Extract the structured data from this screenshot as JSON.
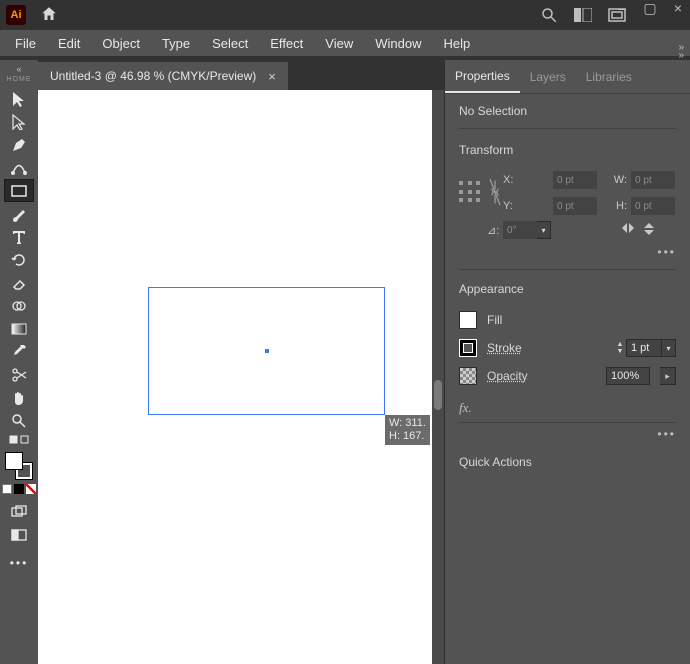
{
  "app": {
    "icon_text": "Ai"
  },
  "window_controls": {
    "minimize": "–",
    "maximize": "▢",
    "close": "×"
  },
  "menubar": [
    "File",
    "Edit",
    "Object",
    "Type",
    "Select",
    "Effect",
    "View",
    "Window",
    "Help"
  ],
  "toolbox": {
    "home_label": "HOME",
    "tools": [
      {
        "name": "selection-tool",
        "selected": false
      },
      {
        "name": "direct-selection-tool",
        "selected": false
      },
      {
        "name": "pen-tool",
        "selected": false
      },
      {
        "name": "curvature-tool",
        "selected": false
      },
      {
        "name": "rectangle-tool",
        "selected": true
      },
      {
        "name": "paintbrush-tool",
        "selected": false
      },
      {
        "name": "type-tool",
        "selected": false
      },
      {
        "name": "rotate-tool",
        "selected": false
      },
      {
        "name": "eraser-tool",
        "selected": false
      },
      {
        "name": "shape-builder-tool",
        "selected": false
      },
      {
        "name": "gradient-tool",
        "selected": false
      },
      {
        "name": "eyedropper-tool",
        "selected": false
      },
      {
        "name": "scissors-tool",
        "selected": false
      },
      {
        "name": "hand-tool",
        "selected": false
      },
      {
        "name": "zoom-tool",
        "selected": false
      }
    ],
    "small_tools": [
      {
        "name": "drawing-mode-normal-icon"
      },
      {
        "name": "screen-mode-icon"
      }
    ]
  },
  "document": {
    "tab_title": "Untitled-3 @ 46.98 % (CMYK/Preview)",
    "dim_tip": "W: 311.\nH: 167."
  },
  "right_panel": {
    "tabs": [
      "Properties",
      "Layers",
      "Libraries"
    ],
    "active_tab": 0,
    "status": "No Selection",
    "transform": {
      "title": "Transform",
      "x_label": "X:",
      "x_value": "0 pt",
      "y_label": "Y:",
      "y_value": "0 pt",
      "w_label": "W:",
      "w_value": "0 pt",
      "h_label": "H:",
      "h_value": "0 pt",
      "angle_label": "⊿:",
      "angle_value": "0°"
    },
    "appearance": {
      "title": "Appearance",
      "fill_label": "Fill",
      "stroke_label": "Stroke",
      "stroke_value": "1 pt",
      "opacity_label": "Opacity",
      "opacity_value": "100%",
      "fx_label": "fx."
    },
    "quick_actions_title": "Quick Actions"
  },
  "chart_data": null
}
